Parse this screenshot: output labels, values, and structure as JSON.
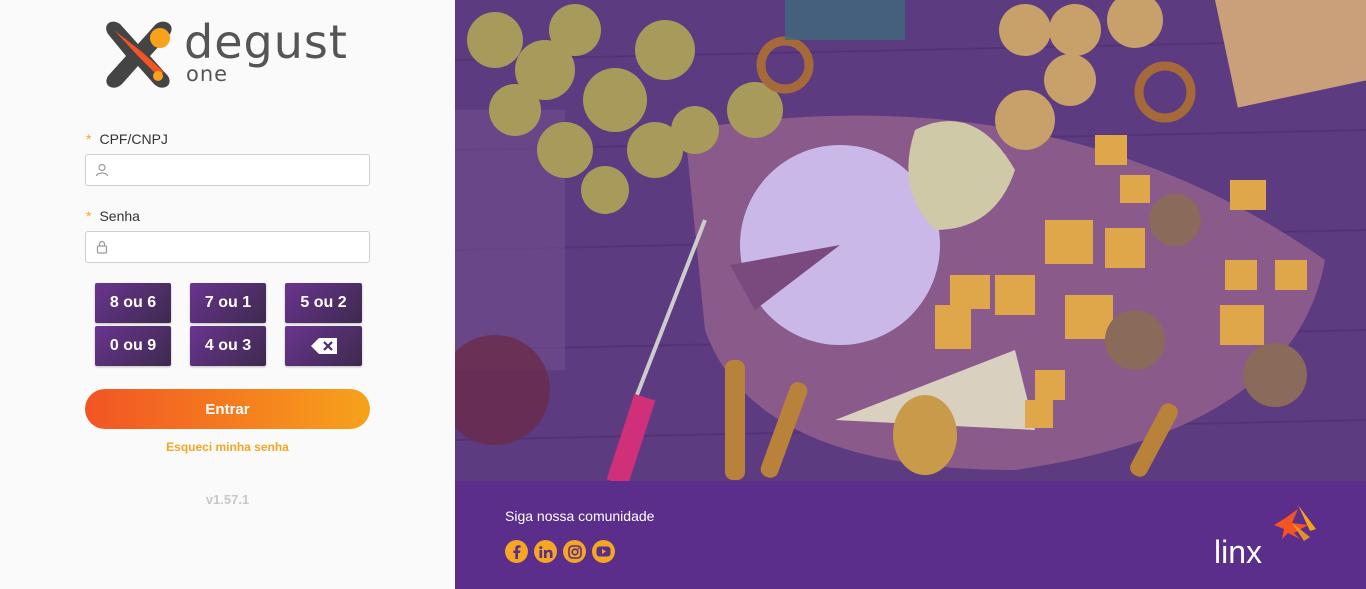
{
  "brand": {
    "name": "degust",
    "sub": "one"
  },
  "form": {
    "cpf_label": "CPF/CNPJ",
    "password_label": "Senha",
    "required_mark": "*",
    "cpf_value": "",
    "password_value": ""
  },
  "keypad": [
    "8 ou 6",
    "7 ou 1",
    "5 ou 2",
    "0 ou 9",
    "4 ou 3"
  ],
  "actions": {
    "submit_label": "Entrar",
    "forgot_label": "Esqueci minha senha"
  },
  "version": "v1.57.1",
  "footer": {
    "title": "Siga nossa comunidade",
    "socials": [
      "facebook-icon",
      "linkedin-icon",
      "instagram-icon",
      "youtube-icon"
    ],
    "partner_logo": "linx"
  },
  "colors": {
    "accent_orange": "#f5a623",
    "gradient_start": "#f25424",
    "gradient_end": "#f7a21b",
    "purple": "#5b2e8c",
    "key_purple": "#6a3490"
  }
}
